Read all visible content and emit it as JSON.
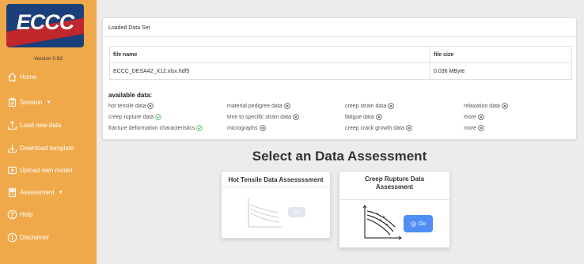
{
  "sidebar": {
    "logo_text": "ECCC",
    "version": "Version 0.92",
    "items": [
      {
        "label": "Home",
        "icon": "home-icon"
      },
      {
        "label": "Session",
        "icon": "clipboard-icon",
        "caret": "▼"
      },
      {
        "label": "Load new data",
        "icon": "upload-icon"
      },
      {
        "label": "Download template",
        "icon": "download-icon"
      },
      {
        "label": "Upload own model",
        "icon": "file-upload-icon"
      },
      {
        "label": "Assessment",
        "icon": "calculator-icon",
        "caret": "▼"
      },
      {
        "label": "Help",
        "icon": "question-circle-icon"
      },
      {
        "label": "Disclaimer",
        "icon": "info-circle-icon"
      }
    ]
  },
  "loaded_panel": {
    "title": "Loaded Data Set",
    "columns": [
      "file name",
      "file size"
    ],
    "row": {
      "file_name": "ECCC_DESA42_X12.xlsx.hdf5",
      "file_size": "0.036 MByte"
    },
    "available_title": "available data:",
    "available": [
      {
        "label": "hot tensile data",
        "status": "missing"
      },
      {
        "label": "material pedigree data",
        "status": "missing"
      },
      {
        "label": "creep strain data",
        "status": "missing"
      },
      {
        "label": "relaxation data",
        "status": "missing"
      },
      {
        "label": "creep rupture data",
        "status": "available"
      },
      {
        "label": "time to specific strain data",
        "status": "missing"
      },
      {
        "label": "fatigue data",
        "status": "missing"
      },
      {
        "label": "more",
        "status": "missing"
      },
      {
        "label": "fracture deformation characteristics",
        "status": "available"
      },
      {
        "label": "micrographs",
        "status": "missing"
      },
      {
        "label": "creep crack growth data",
        "status": "missing"
      },
      {
        "label": "more",
        "status": "missing"
      }
    ]
  },
  "assessment": {
    "heading": "Select an Data Assessment",
    "cards": [
      {
        "title": "Hot Tensile Data Assessssment",
        "button": "Go",
        "enabled": false
      },
      {
        "title": "Creep Rupture Data Assessment",
        "button": "Go",
        "enabled": true
      }
    ]
  },
  "colors": {
    "sidebar": "#efa94a",
    "accent_button": "#4f8ef5",
    "ok": "#3aa84b",
    "missing": "#444444"
  }
}
